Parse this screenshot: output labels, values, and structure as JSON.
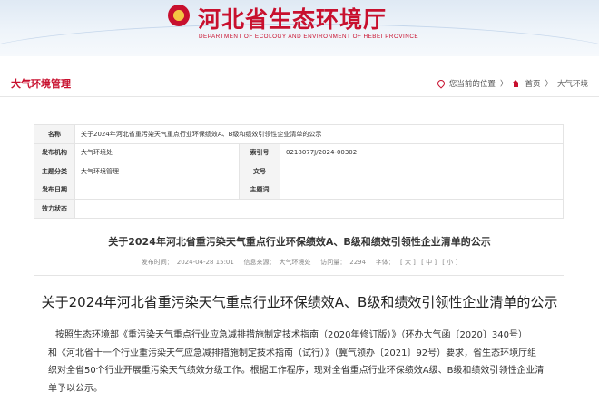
{
  "header": {
    "site_title": "河北省生态环境厅",
    "site_subtitle": "DEPARTMENT OF ECOLOGY AND ENVIRONMENT OF HEBEI PROVINCE",
    "brand_color": "#c8102e"
  },
  "section_bar": {
    "section_title": "大气环境管理",
    "breadcrumb_prefix": "您当前的位置",
    "breadcrumb_sep": "〉",
    "crumbs": [
      "首页",
      "大气环境"
    ]
  },
  "info_table": {
    "name_label": "名称",
    "name_value": "关于2024年河北省重污染天气重点行业环保绩效A、B级和绩效引领性企业清单的公示",
    "org_label": "发布机构",
    "org_value": "大气环境处",
    "index_label": "索引号",
    "index_value": "0218077J/2024-00302",
    "category_label": "主题分类",
    "category_value": "大气环境管理",
    "docno_label": "文号",
    "docno_value": "",
    "date_label": "发布日期",
    "date_value": "",
    "keyword_label": "主题词",
    "keyword_value": "",
    "status_label": "效力状态",
    "status_value": ""
  },
  "doc_title": "关于2024年河北省重污染天气重点行业环保绩效A、B级和绩效引领性企业清单的公示",
  "meta": {
    "published_label": "发布时间：",
    "published_value": "2024-04-28 15:01",
    "source_label": "信息来源：",
    "source_value": "大气环境处",
    "views_label": "访问量：",
    "views_value": "2294",
    "font_label": "字体：",
    "font_large": "[ 大 ]",
    "font_medium": "[ 中 ]",
    "font_small": "[ 小 ]"
  },
  "article": {
    "title": "关于2024年河北省重污染天气重点行业环保绩效A、B级和绩效引领性企业清单的公示",
    "lines": [
      "按照生态环境部《重污染天气重点行业应急减排措施制定技术指南（2020年修订版）》（环办大气函〔2020〕340号）",
      "和《河北省十一个行业重污染天气应急减排措施制定技术指南（试行）》（冀气领办〔2021〕92号）要求，省生态环境厅组",
      "织对全省50个行业开展重污染天气绩效分级工作。根据工作程序，现对全省重点行业环保绩效A级、B级和绩效引领性企业清",
      "单予以公示。"
    ]
  }
}
